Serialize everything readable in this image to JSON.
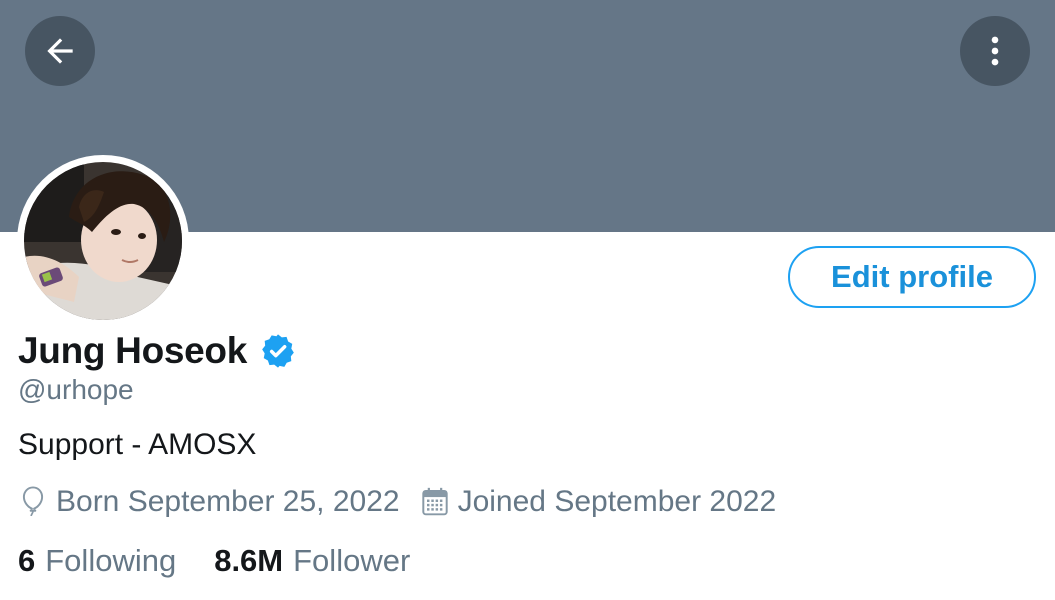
{
  "header": {
    "back_icon": "arrow-left-icon",
    "more_icon": "vertical-ellipsis-icon",
    "banner_color": "#657687"
  },
  "profile": {
    "avatar": "profile-photo",
    "edit_button_label": "Edit profile",
    "display_name": "Jung Hoseok",
    "verified_icon": "verified-badge-icon",
    "handle": "@urhope",
    "bio": "Support - AMOSX",
    "birth": {
      "icon": "balloon-icon",
      "text": "Born September 25, 2022"
    },
    "joined": {
      "icon": "calendar-icon",
      "text": "Joined September 2022"
    }
  },
  "stats": {
    "following_count": "6",
    "following_label": "Following",
    "followers_count": "8.6M",
    "followers_label": "Follower"
  },
  "colors": {
    "accent": "#1da1f2",
    "text_primary": "#14171a",
    "text_secondary": "#657786"
  }
}
